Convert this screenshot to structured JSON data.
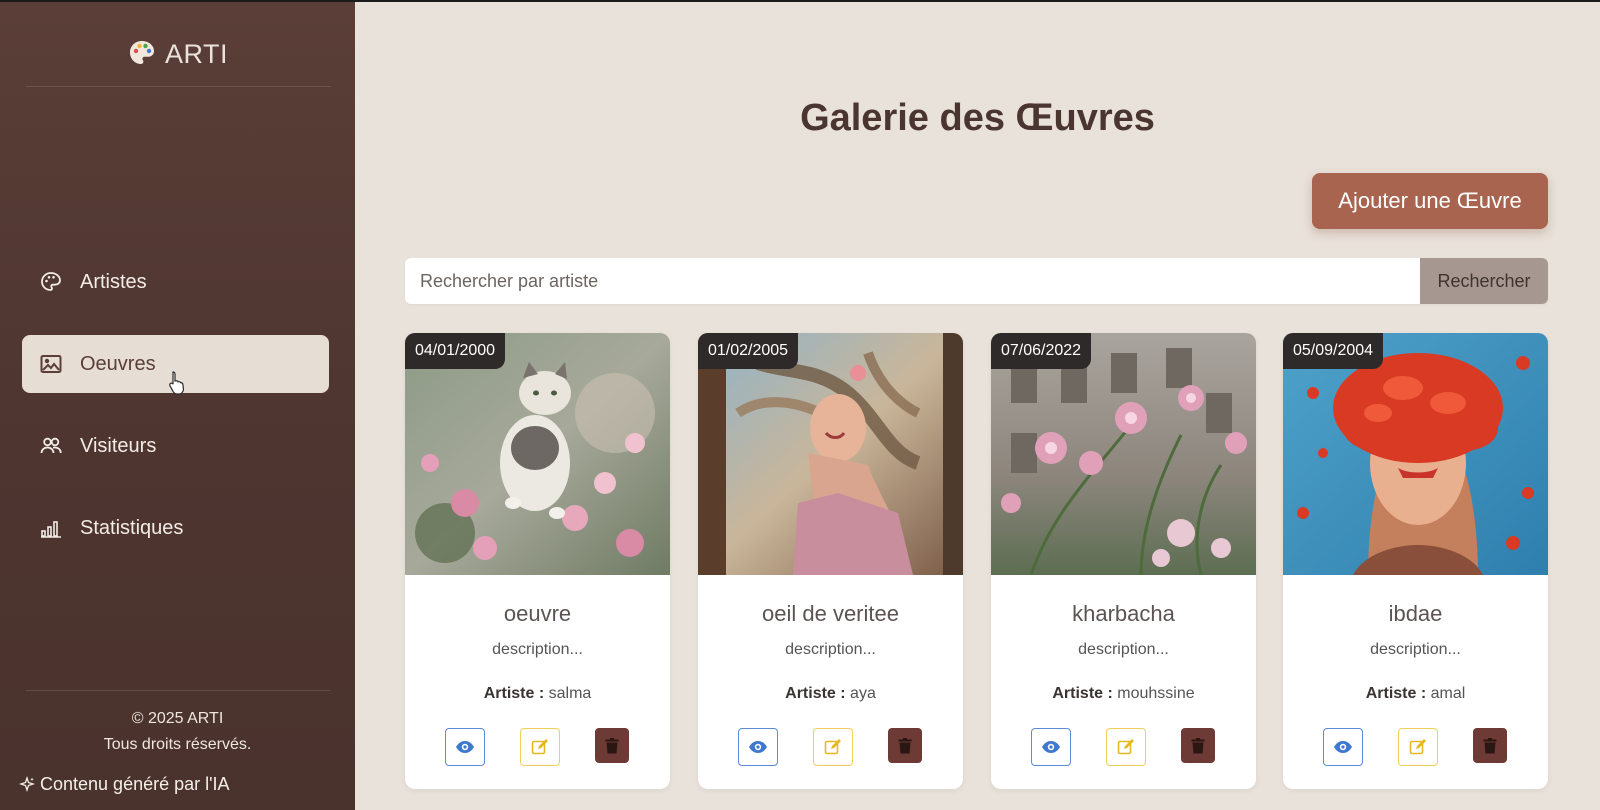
{
  "brand": {
    "name": "ARTI",
    "icon": "palette-icon"
  },
  "nav": [
    {
      "label": "Artistes",
      "icon": "palette-icon"
    },
    {
      "label": "Oeuvres",
      "icon": "image-icon",
      "active": true
    },
    {
      "label": "Visiteurs",
      "icon": "users-icon"
    },
    {
      "label": "Statistiques",
      "icon": "bar-chart-icon"
    }
  ],
  "footer": {
    "copyright": "© 2025 ARTI",
    "rights": "Tous droits réservés."
  },
  "ai_note": "Contenu généré par l'IA",
  "page": {
    "title": "Galerie des Œuvres",
    "add_button": "Ajouter une Œuvre",
    "search": {
      "placeholder": "Rechercher par artiste",
      "value": "",
      "button": "Rechercher"
    }
  },
  "artist_label": "Artiste :",
  "cards": [
    {
      "date": "04/01/2000",
      "title": "oeuvre",
      "description": "description...",
      "artist": "salma",
      "image": "cat-in-flowers-painting"
    },
    {
      "date": "01/02/2005",
      "title": "oeil de veritee",
      "description": "description...",
      "artist": "aya",
      "image": "woman-windswept-hair-painting"
    },
    {
      "date": "07/06/2022",
      "title": "kharbacha",
      "description": "description...",
      "artist": "mouhssine",
      "image": "pink-flowers-balcony-painting"
    },
    {
      "date": "05/09/2004",
      "title": "ibdae",
      "description": "description...",
      "artist": "amal",
      "image": "red-petals-face-painting"
    }
  ],
  "colors": {
    "sidebar": "#5a3e37",
    "background": "#e9e2da",
    "accent": "#a8644f",
    "view": "#5b8cd6",
    "edit": "#f0cf5a",
    "delete": "#6e3a35"
  }
}
